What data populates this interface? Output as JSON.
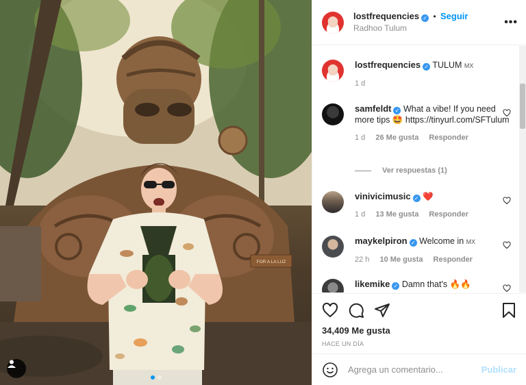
{
  "post": {
    "author": "lostfrequencies",
    "follow_label": "Seguir",
    "separator": "•",
    "location": "Radhoo Tulum",
    "more_icon": "more-horizontal-icon",
    "more_label": "•••",
    "caption_text": "TULUM",
    "caption_flag": "MX",
    "caption_time": "1 d",
    "likes": "34,409 Me gusta",
    "time_ago": "HACE UN DÍA",
    "sign_label": "FOR A LA LUZ"
  },
  "comments": [
    {
      "user": "samfeldt",
      "text": "What a vibe! If you need more tips 🤩 https://tinyurl.com/SFTulum",
      "time": "1 d",
      "likes": "26 Me gusta",
      "reply": "Responder",
      "view_replies": "Ver respuestas (1)"
    },
    {
      "user": "vinivicimusic",
      "text": "❤️",
      "time": "1 d",
      "likes": "13 Me gusta",
      "reply": "Responder"
    },
    {
      "user": "maykelpiron",
      "text": "Welcome in",
      "flag": "MX",
      "time": "22 h",
      "likes": "10 Me gusta",
      "reply": "Responder"
    },
    {
      "user": "likemike",
      "text": "Damn that's 🔥🔥"
    }
  ],
  "add_comment": {
    "placeholder": "Agrega un comentario...",
    "publish_label": "Publicar"
  },
  "colors": {
    "accent": "#0095f6",
    "verified": "#3897f0",
    "muted": "#8e8e8e",
    "publish_disabled": "#b2dffc"
  }
}
